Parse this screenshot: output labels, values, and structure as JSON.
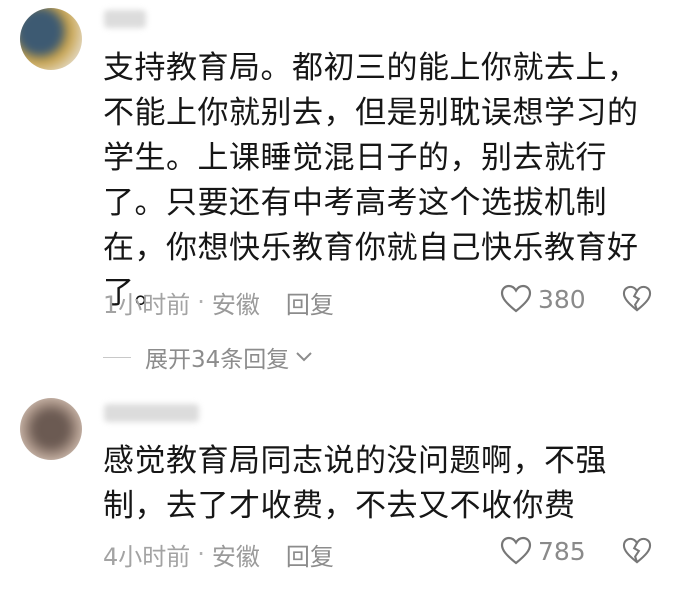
{
  "comments": [
    {
      "text": "支持教育局。都初三的能上你就去上，不能上你就别去，但是别耽误想学习的学生。上课睡觉混日子的，别去就行了。只要还有中考高考这个选拔机制在，你想快乐教育你就自己快乐教育好了。",
      "time": "1小时前",
      "location": "安徽",
      "reply_label": "回复",
      "likes": "380",
      "avatar_colors": [
        "#5a6b7a",
        "#c8a24a",
        "#2f4d63"
      ]
    },
    {
      "text": "感觉教育局同志说的没问题啊，不强制，去了才收费，不去又不收你费",
      "time": "4小时前",
      "location": "安徽",
      "reply_label": "回复",
      "likes": "785",
      "avatar_colors": [
        "#8f7c70",
        "#bca79a",
        "#5e4e47"
      ]
    }
  ],
  "expand_replies": "展开34条回复",
  "icons": {
    "like": "heart-outline-icon",
    "dislike": "broken-heart-icon",
    "expand": "chevron-down-icon"
  }
}
